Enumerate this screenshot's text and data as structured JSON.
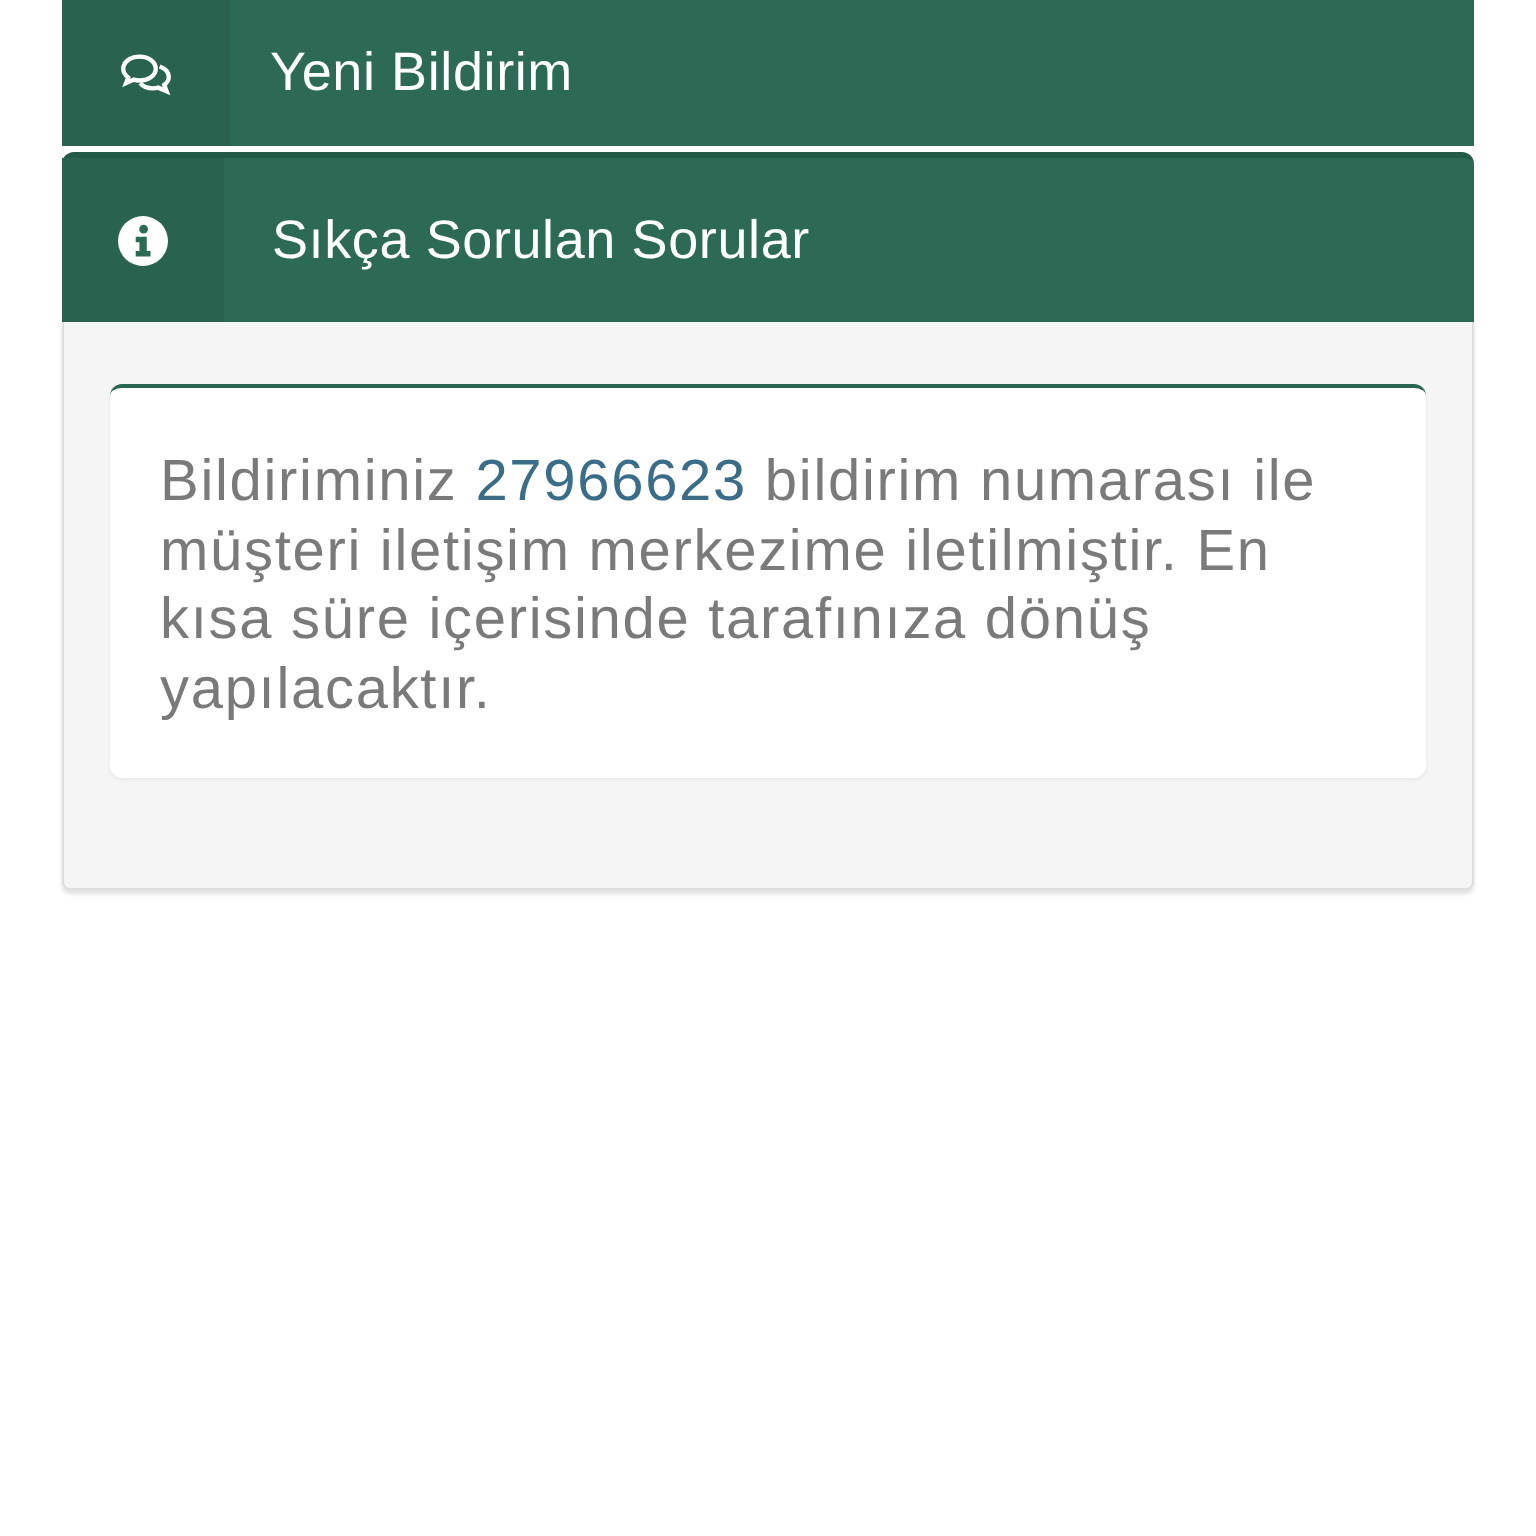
{
  "menu_items": [
    {
      "kind": "comments",
      "label": "Yeni Bildirim"
    },
    {
      "kind": "info",
      "label": "Sıkça Sorulan Sorular"
    }
  ],
  "panel": {
    "message": {
      "before": "Bildiriminiz",
      "number": "27966623",
      "after": "bildirim numarası ile müşteri iletişim merkezime iletilmiştir. En kısa süre içerisinde tarafınıza dönüş yapılacaktır."
    }
  }
}
